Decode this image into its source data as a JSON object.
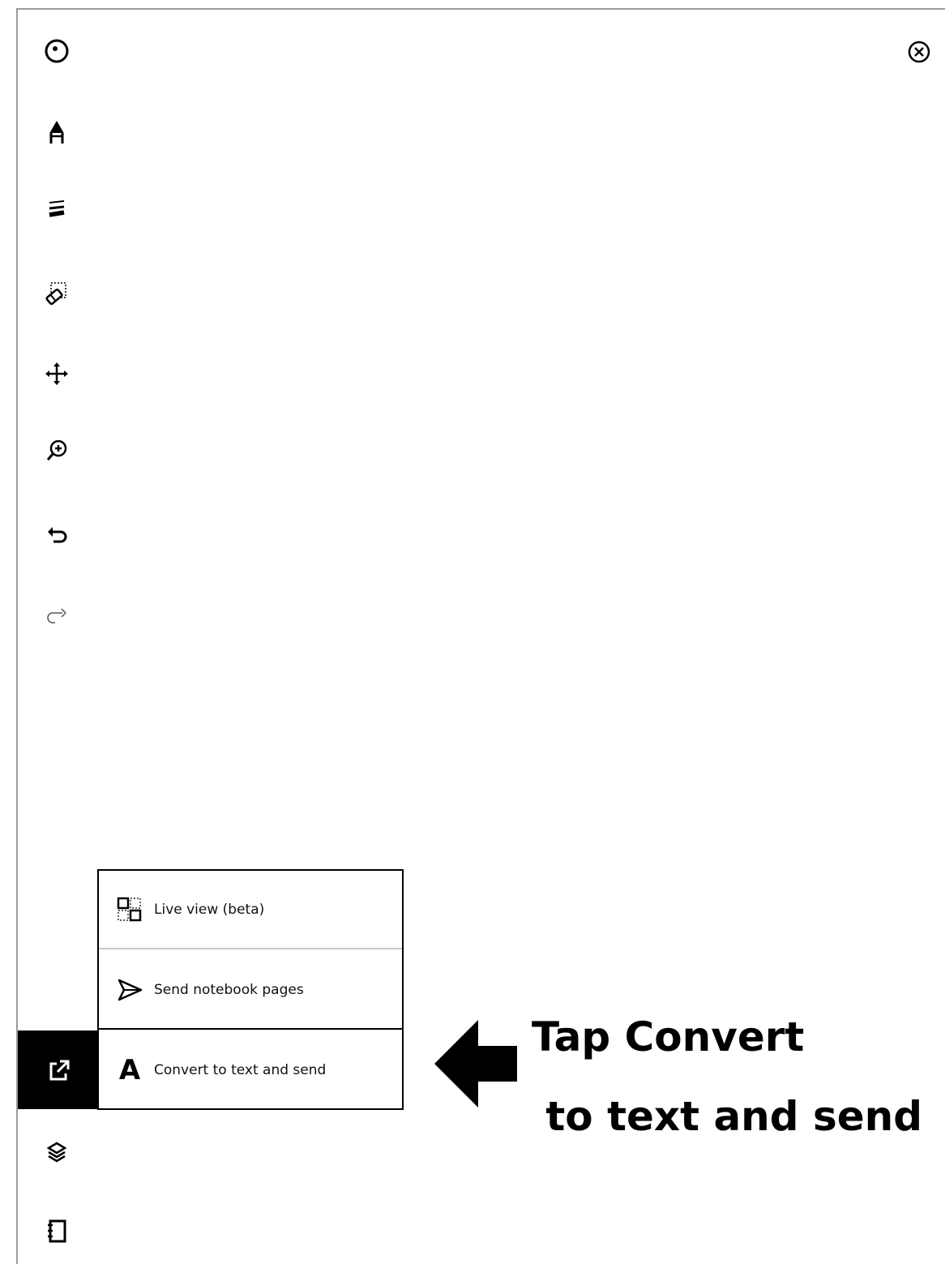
{
  "toolbar": {
    "tools": [
      {
        "icon": "pen-tip-icon"
      },
      {
        "icon": "pen-style-icon"
      },
      {
        "icon": "stroke-thickness-icon"
      },
      {
        "icon": "selection-eraser-icon"
      },
      {
        "icon": "move-icon"
      },
      {
        "icon": "zoom-icon"
      },
      {
        "icon": "undo-icon"
      },
      {
        "icon": "redo-icon"
      },
      {
        "icon": "share-icon"
      },
      {
        "icon": "layers-icon"
      },
      {
        "icon": "notebook-icon"
      }
    ],
    "close_icon": "close-icon"
  },
  "share_menu": {
    "items": [
      {
        "label": "Live view (beta)",
        "icon": "live-view-icon"
      },
      {
        "label": "Send notebook pages",
        "icon": "send-icon"
      },
      {
        "label": "Convert to text and send",
        "icon": "convert-text-icon",
        "glyph": "A"
      }
    ]
  },
  "annotation": {
    "line1": "Tap Convert",
    "line2": " to text and send"
  }
}
